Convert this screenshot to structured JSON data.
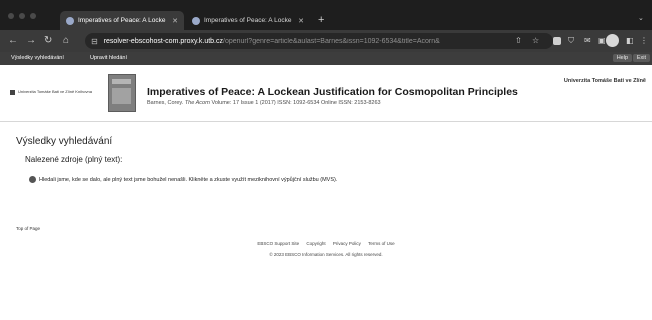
{
  "browser": {
    "tabs": [
      {
        "title": "Imperatives of Peace: A Locke",
        "active": true
      },
      {
        "title": "Imperatives of Peace: A Locke",
        "active": false
      }
    ],
    "new_tab": "+",
    "url_host": "resolver-ebscohost-com.proxy.k.utb.cz",
    "url_rest": "/openurl?genre=article&aulast=Barnes&issn=1092-6534&title=Acorn&"
  },
  "ebsco_toolbar": {
    "search_results_link": "Výsledky vyhledávání",
    "new_search_link": "Upravit hledání",
    "help": "Help",
    "exit": "Exit"
  },
  "header": {
    "logo_text": "Univerzita Tomáše Bati ve Zlíně Knihovna",
    "institution": "Univerzita Tomáše Bati ve Zlíně",
    "article_title": "Imperatives of Peace: A Lockean Justification for Cosmopolitan Principles",
    "article_authors": "Barnes, Corey.",
    "article_journal": "The Acorn",
    "article_details": "Volume: 17 Issue 1 (2017) ISSN: 1092-6534 Online ISSN: 2153-8263"
  },
  "main": {
    "heading": "Výsledky vyhledávání",
    "subheading": "Nalezené zdroje (plný text):",
    "notice": "Hledali jsme, kde se dalo, ale plný text jsme bohužel nenašli. Klikněte a zkuste využít meziknihovní výpůjční službu (MVS)."
  },
  "footer": {
    "top_of_page": "Top of Page",
    "links": [
      "EBSCO Support Site",
      "Copyright",
      "Privacy Policy",
      "Terms of Use"
    ],
    "copyright": "© 2023 EBSCO Information Services. All rights reserved."
  }
}
